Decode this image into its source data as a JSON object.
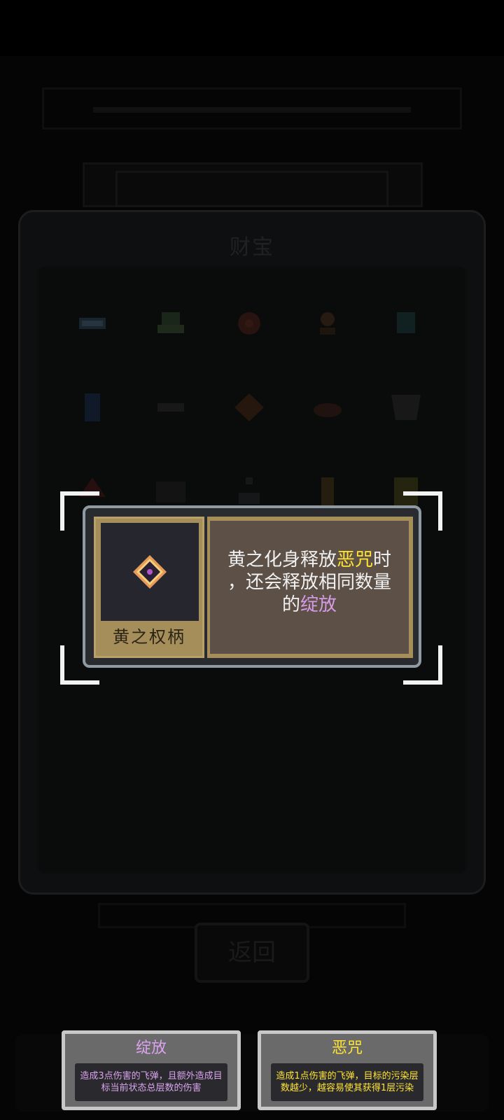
{
  "background": {
    "panel_title": "财宝",
    "back_button_label": "返回",
    "grid_items": [
      "scroll-icon",
      "hat-icon",
      "flower-icon",
      "trophy-icon",
      "gauntlet-icon",
      "jar-icon",
      "key-icon",
      "diamond-icon",
      "bowl-icon",
      "mask-icon",
      "leaf-icon",
      "box-icon",
      "stack-icon",
      "potion-icon",
      "banner-icon"
    ]
  },
  "popup": {
    "item_name": "黄之权柄",
    "item_icon": "yellow-scepter-icon",
    "description_parts": [
      "黄之化身释放",
      "恶咒",
      "时\n，还会释放相同数量\n的",
      "绽放"
    ]
  },
  "tooltips": [
    {
      "title": "绽放",
      "body": "造成3点伤害的飞弹，且额外造成目标当前状态总层数的伤害",
      "color": "#d9a4ee"
    },
    {
      "title": "恶咒",
      "body": "造成1点伤害的飞弹，目标的污染层数越少，越容易使其获得1层污染",
      "color": "#ffe433"
    }
  ],
  "colors": {
    "yellow_keyword": "#ffe433",
    "purple_keyword": "#d79be8",
    "card_gold": "#a58e5a",
    "card_brown": "#5c5047"
  }
}
